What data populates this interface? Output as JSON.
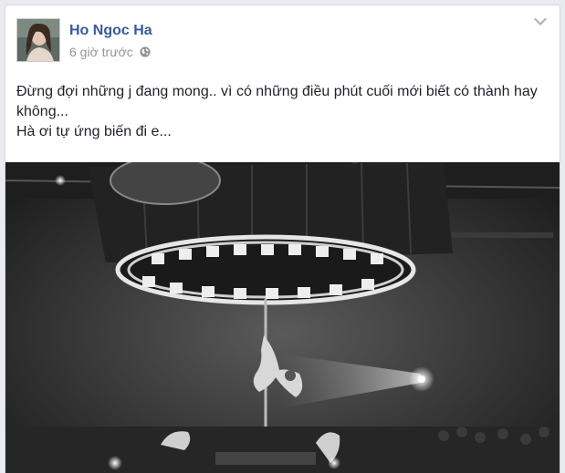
{
  "post": {
    "author": "Ho Ngoc Ha",
    "timestamp": "6 giờ trước",
    "privacy_icon": "globe-icon",
    "menu_icon": "chevron-down-icon",
    "text_line1": "Đừng đợi những j đang mong.. vì có những điều phút cuối mới biết có thành hay không...",
    "text_line2": "Hà ơi tự ứng biến đi e...",
    "photo_subject": "black-and-white stage performance photo"
  }
}
